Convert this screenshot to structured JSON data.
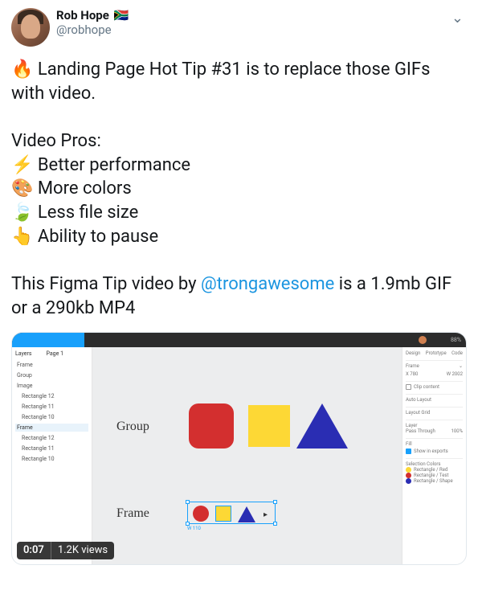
{
  "author": {
    "display_name": "Rob Hope",
    "flag": "🇿🇦",
    "handle": "@robhope"
  },
  "icons": {
    "chevron_down": "⌄"
  },
  "tweet": {
    "line1_prefix": "🔥 ",
    "line1_rest": "Landing Page Hot Tip #31 is to replace those GIFs with video.",
    "pros_heading": "Video Pros:",
    "pros": {
      "p1": "⚡ Better performance",
      "p2": "🎨 More colors",
      "p3": "🍃 Less file size",
      "p4": "👆 Ability to pause"
    },
    "closing_before": "This Figma Tip video by ",
    "mention": "@trongawesome",
    "closing_after": " is a 1.9mb GIF or a 290kb MP4"
  },
  "media": {
    "time": "0:07",
    "views": "1.2K views"
  },
  "figma": {
    "topbar_pct": "88%",
    "left": {
      "tab_a": "Layers",
      "tab_b": "Page 1",
      "items": {
        "i1": "Frame",
        "i2": "Group",
        "i3": "Image",
        "i4": "Rectangle 12",
        "i5": "Rectangle 11",
        "i6": "Rectangle 10",
        "sel": "Frame",
        "i7": "Rectangle 12",
        "i8": "Rectangle 11",
        "i9": "Rectangle 10"
      }
    },
    "canvas": {
      "group_label": "Group",
      "frame_label": "Frame"
    },
    "right": {
      "design": "Design",
      "prototype": "Prototype",
      "code": "Code",
      "frame": "Frame",
      "x": "X  780",
      "w": "W  2002",
      "clip": "Clip content",
      "autolayout": "Auto Layout",
      "layoutgrid": "Layout Grid",
      "layer": "Layer",
      "passthrough": "Pass Through",
      "pct": "100%",
      "fill": "Fill",
      "show_exports": "Show in exports",
      "selcolors": "Selection Colors",
      "c1": "Rectangle / Red",
      "c2": "Rectangle / Test",
      "c3": "Rectangle / Shape"
    }
  }
}
